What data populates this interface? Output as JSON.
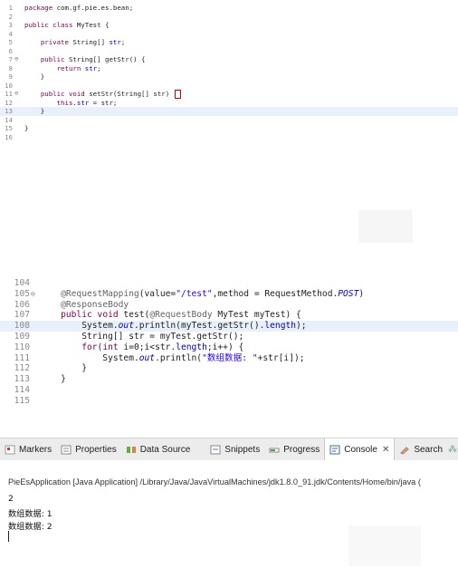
{
  "top_editor": {
    "lines": [
      {
        "n": "1",
        "text": "package com.gf.pie.es.bean;"
      },
      {
        "n": "2",
        "text": ""
      },
      {
        "n": "3",
        "text": "public class MyTest {"
      },
      {
        "n": "4",
        "text": ""
      },
      {
        "n": "5",
        "text": "    private String[] str;"
      },
      {
        "n": "6",
        "text": ""
      },
      {
        "n": "7",
        "text": "    public String[] getStr() {"
      },
      {
        "n": "8",
        "text": "        return str;"
      },
      {
        "n": "9",
        "text": "    }"
      },
      {
        "n": "10",
        "text": ""
      },
      {
        "n": "11",
        "text": "    public void setStr(String[] str) {"
      },
      {
        "n": "12",
        "text": "        this.str = str;"
      },
      {
        "n": "13",
        "text": "    }"
      },
      {
        "n": "14",
        "text": ""
      },
      {
        "n": "15",
        "text": "}"
      },
      {
        "n": "16",
        "text": ""
      }
    ]
  },
  "bottom_editor": {
    "lines": [
      {
        "n": "104",
        "text": ""
      },
      {
        "n": "105",
        "text": "    @RequestMapping(value=\"/test\",method = RequestMethod.POST)"
      },
      {
        "n": "106",
        "text": "    @ResponseBody"
      },
      {
        "n": "107",
        "text": "    public void test(@RequestBody MyTest myTest) {"
      },
      {
        "n": "108",
        "text": "        System.out.println(myTest.getStr().length);"
      },
      {
        "n": "109",
        "text": "        String[] str = myTest.getStr();"
      },
      {
        "n": "110",
        "text": "        for(int i=0;i<str.length;i++) {"
      },
      {
        "n": "111",
        "text": "            System.out.println(\"数组数据: \"+str[i]);"
      },
      {
        "n": "112",
        "text": "        }"
      },
      {
        "n": "113",
        "text": "    }"
      },
      {
        "n": "114",
        "text": ""
      },
      {
        "n": "115",
        "text": ""
      }
    ]
  },
  "tabs": [
    {
      "label": "Markers",
      "icon": "markers-icon"
    },
    {
      "label": "Properties",
      "icon": "properties-icon"
    },
    {
      "label": "Data Source",
      "icon": "data-source-icon"
    },
    {
      "label": "Snippets",
      "icon": "snippets-icon"
    },
    {
      "label": "Progress",
      "icon": "progress-icon"
    },
    {
      "label": "Console",
      "icon": "console-icon",
      "active": true
    },
    {
      "label": "Search",
      "icon": "search-icon"
    }
  ],
  "console": {
    "title": "PieEsApplication [Java Application] /Library/Java/JavaVirtualMachines/jdk1.8.0_91.jdk/Contents/Home/bin/java (",
    "output": [
      "2",
      "数组数据: 1",
      "数组数据: 2"
    ]
  },
  "colors": {
    "keyword": "#7f0055",
    "field": "#0000c0",
    "string": "#2a00ff",
    "annotation": "#646464",
    "highlight": "#e8f0fb"
  }
}
